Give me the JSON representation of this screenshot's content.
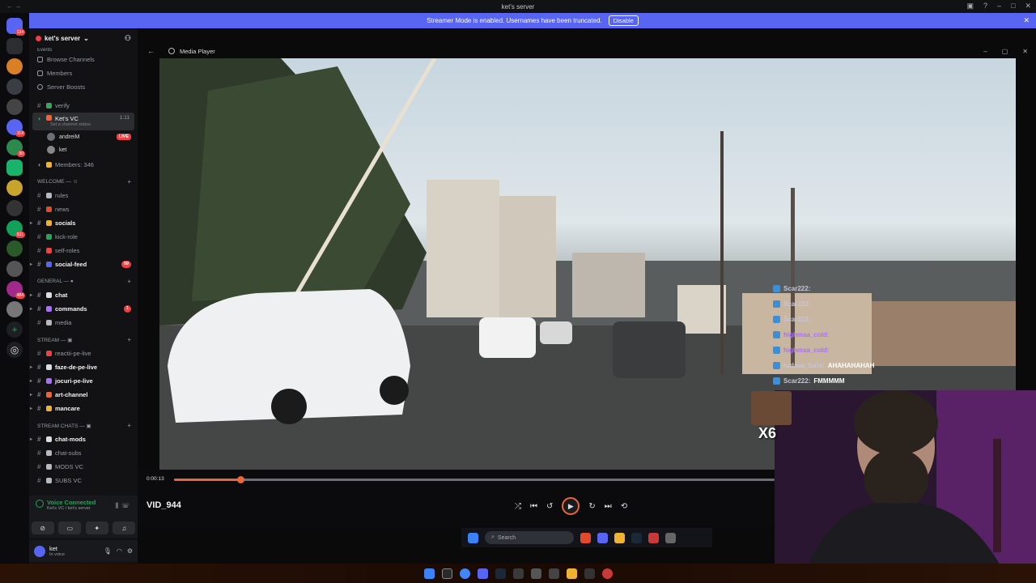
{
  "window": {
    "title": "ket's server"
  },
  "banner": {
    "text": "Streamer Mode is enabled. Usernames have been truncated.",
    "button": "Disable"
  },
  "rail": {
    "badges": [
      "134",
      "114",
      "90",
      "531",
      "484"
    ]
  },
  "sidebar": {
    "server_name": "ket's server",
    "menu": [
      "Events",
      "Browse Channels",
      "Members",
      "Server Boosts"
    ],
    "verify": "verify",
    "voice_channel": {
      "name": "Ket's VC",
      "time": "1:11",
      "status": "Set a channel status"
    },
    "voice_users": [
      {
        "name": "andreiM",
        "live": "LIVE"
      },
      {
        "name": "ket"
      }
    ],
    "members": "Members: 346",
    "categories": {
      "welcome": "WELCOME — ☺",
      "general": "GENERAL — ●",
      "stream": "STREAM — ▣",
      "stream_chats": "STREAM CHATS — ▣"
    },
    "welcome_channels": [
      {
        "name": "rules",
        "bold": false
      },
      {
        "name": "news",
        "bold": false
      },
      {
        "name": "socials",
        "bold": true
      },
      {
        "name": "kick-role",
        "bold": false
      },
      {
        "name": "self-roles",
        "bold": false
      },
      {
        "name": "social-feed",
        "bold": true,
        "badge": "99"
      }
    ],
    "general_channels": [
      {
        "name": "chat",
        "bold": true
      },
      {
        "name": "commands",
        "bold": true,
        "badge": "1"
      },
      {
        "name": "media",
        "bold": false
      }
    ],
    "stream_channels": [
      {
        "name": "reactii-pe-live",
        "bold": false
      },
      {
        "name": "faze-de-pe-live",
        "bold": true
      },
      {
        "name": "jocuri-pe-live",
        "bold": true
      },
      {
        "name": "art-channel",
        "bold": true
      },
      {
        "name": "mancare",
        "bold": true
      }
    ],
    "stream_chat_channels": [
      {
        "name": "chat-mods",
        "bold": true
      },
      {
        "name": "chat-subs",
        "bold": false
      },
      {
        "name": "MODS VC",
        "bold": false
      },
      {
        "name": "SUBS VC",
        "bold": false
      }
    ]
  },
  "voice": {
    "status": "Voice Connected",
    "location": "Ket's VC / ket's server"
  },
  "user": {
    "name": "ket",
    "status": "In voice"
  },
  "player": {
    "title": "Media Player",
    "time": "0:00:13",
    "progress": 0.11,
    "filename": "VID_944",
    "search_placeholder": "Search"
  },
  "chat_overlay": [
    {
      "user": "Scar222:",
      "msg": "",
      "purple": false
    },
    {
      "user": "Scar222:",
      "msg": "",
      "purple": false
    },
    {
      "user": "Scar222:",
      "msg": "",
      "purple": false
    },
    {
      "user": "highmaa_cold:",
      "msg": "",
      "purple": true
    },
    {
      "user": "highmaa_cold:",
      "msg": "",
      "purple": true
    },
    {
      "user": "rudaaa_furia:",
      "msg": "AHAHAHAHAH",
      "purple": false
    },
    {
      "user": "Scar222:",
      "msg": "FMMMMM",
      "purple": false
    }
  ],
  "emote": {
    "count": "X6"
  },
  "colors": {
    "accent": "#5865f2",
    "live": "#f23f43",
    "voice": "#23a55a",
    "progress": "#e8663a"
  }
}
